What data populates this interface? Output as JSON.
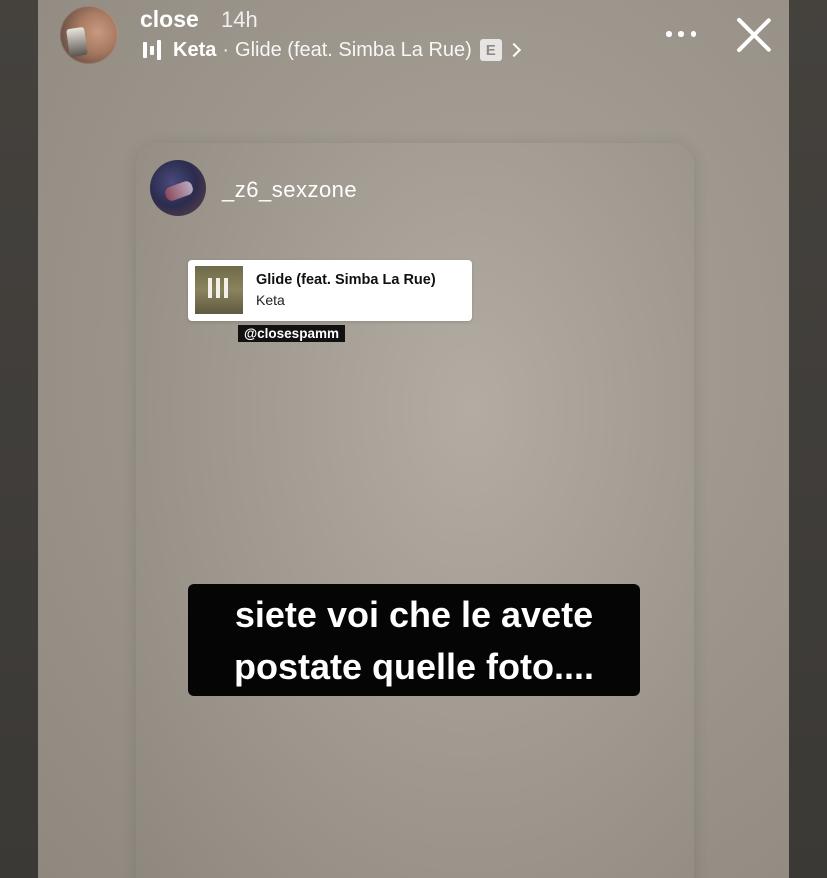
{
  "header": {
    "username": "close",
    "timestamp": "14h",
    "music": {
      "artist": "Keta",
      "separator": "·",
      "track": "Glide (feat. Simba La Rue)",
      "explicit_badge": "E"
    },
    "icons": [
      "music-bars-icon",
      "chevron-right-icon",
      "more-icon",
      "close-icon"
    ]
  },
  "shared_story": {
    "username": "_z6_sexzone",
    "music_sticker": {
      "title": "Glide (feat. Simba La Rue)",
      "artist": "Keta"
    },
    "mention": "@closespamm",
    "caption": {
      "line1": "siete voi che le avete",
      "line2": "postate quelle foto...."
    }
  }
}
